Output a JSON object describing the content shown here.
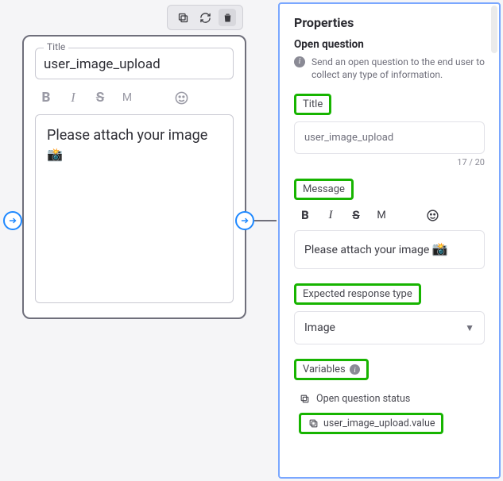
{
  "card": {
    "title_label": "Title",
    "title_value": "user_image_upload",
    "message": "Please attach your image",
    "camera_emoji": "📸"
  },
  "panel": {
    "heading": "Properties",
    "subheading": "Open question",
    "description": "Send an open question to the end user to collect any type of information.",
    "sections": {
      "title_label": "Title",
      "title_value": "user_image_upload",
      "title_counter": "17 / 20",
      "message_label": "Message",
      "message_value": "Please attach your image",
      "camera_emoji": "📸",
      "expected_label": "Expected response type",
      "expected_value": "Image",
      "variables_label": "Variables",
      "var_status": "Open question status",
      "var_value": "user_image_upload.value"
    }
  }
}
